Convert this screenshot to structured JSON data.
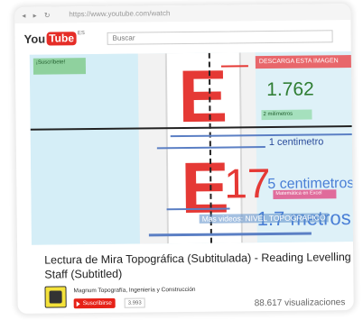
{
  "browser": {
    "url": "https://www.youtube.com/watch"
  },
  "header": {
    "logo_you": "You",
    "logo_tube": "Tube",
    "logo_cc": "ES",
    "search_placeholder": "Buscar"
  },
  "video": {
    "subscribe_tag": "¡Suscríbete!",
    "download_tag": "DESCARGA ESTA IMAGEN",
    "reading_value": "1.762",
    "mm_tag": "2 milímetros",
    "cm_label": "1 centimetro",
    "five_cm_label": "5 centimetros",
    "excel_tag": "Matemática en Excel",
    "metros_label": "1.7 metros",
    "overlay_text": "Mas videos: NIVEL TOPOGRAFICO",
    "staff_digits": "17",
    "staff_letter": "E"
  },
  "info": {
    "title": "Lectura de Mira Topográfica (Subtitulada) - Reading Levelling Staff (Subtitled)",
    "channel_name": "Magnum Topografía, Ingeniería y Construcción",
    "subscribe_label": "Suscribirse",
    "subscriber_count": "3.993",
    "views": "88.617 visualizaciones"
  },
  "colors": {
    "accent": "#e52d27",
    "staff_red": "#e53935",
    "guide_blue": "#5b7fc4"
  }
}
